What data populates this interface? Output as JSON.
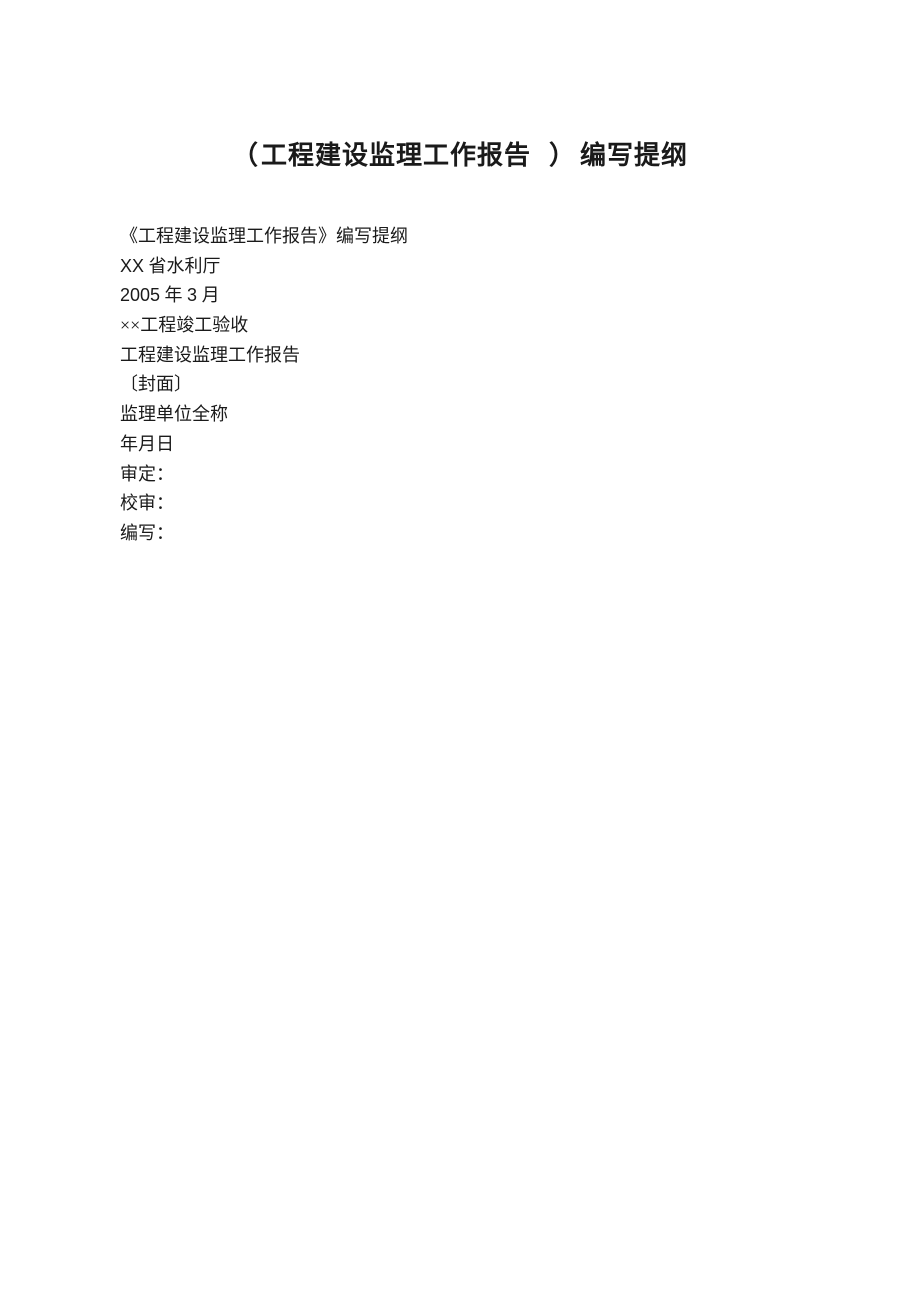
{
  "title": {
    "paren_open": "（",
    "inner": "工程建设监理工作报告",
    "paren_close": "）",
    "suffix": "编写提纲"
  },
  "lines": [
    "《工程建设监理工作报告》编写提纲",
    "XX 省水利厅",
    "2005 年 3 月",
    "××工程竣工验收",
    "工程建设监理工作报告",
    "〔封面〕",
    "监理单位全称",
    "年月日",
    "审定：",
    "校审：",
    "编写："
  ]
}
